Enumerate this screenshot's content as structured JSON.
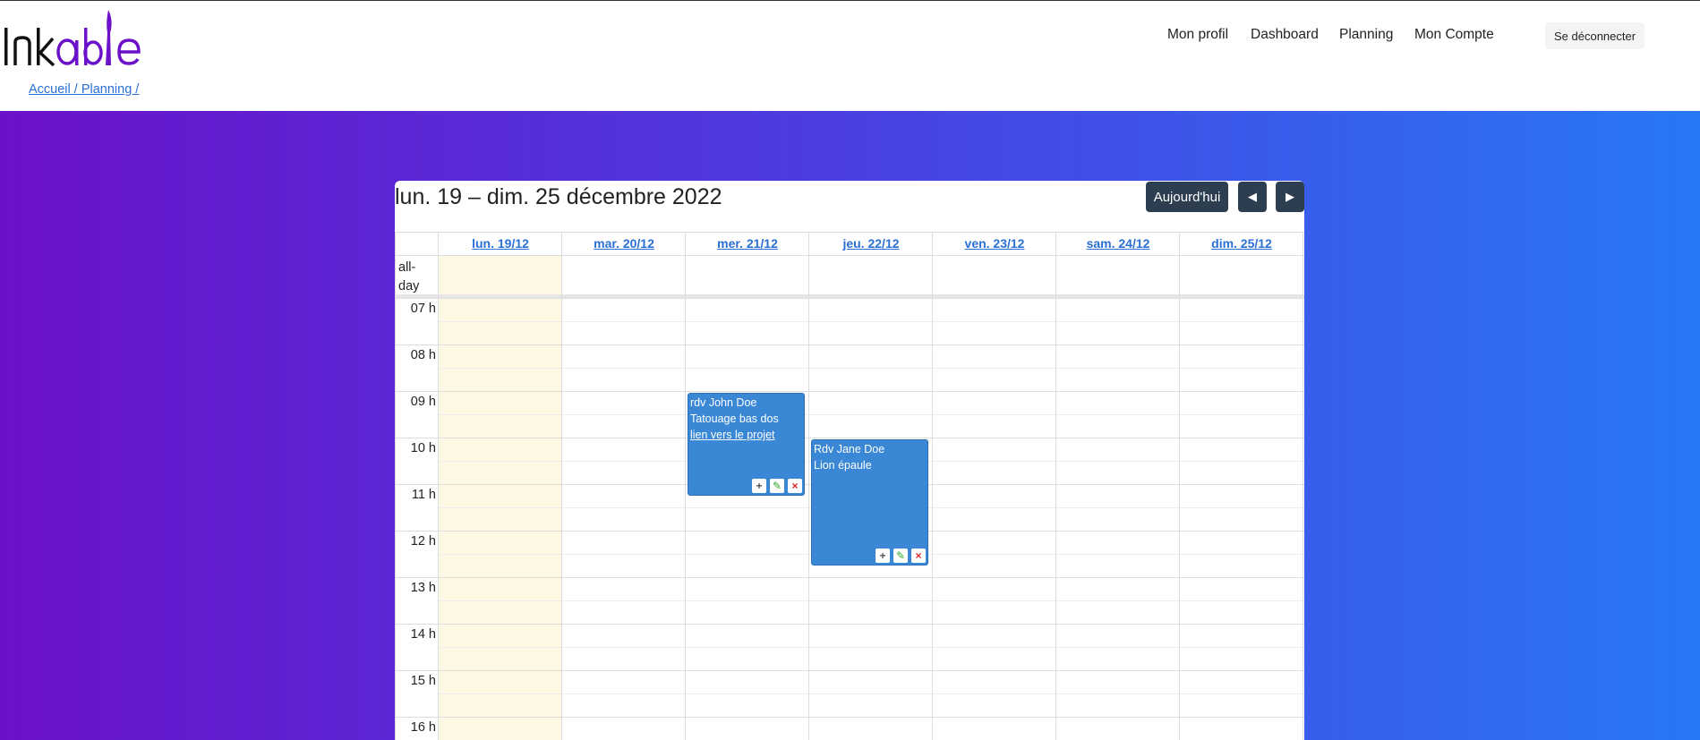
{
  "brand": {
    "name": "Inkable",
    "accent": "#6b11c9"
  },
  "nav": {
    "profile": "Mon profil",
    "dashboard": "Dashboard",
    "planning": "Planning",
    "account": "Mon Compte",
    "logout": "Se déconnecter"
  },
  "breadcrumb": "Accueil / Planning /",
  "calendar": {
    "title": "lun. 19 – dim. 25 décembre 2022",
    "today_button": "Aujourd'hui",
    "prev_icon": "◀",
    "next_icon": "▶",
    "allday_label": "all-day",
    "days": [
      "lun. 19/12",
      "mar. 20/12",
      "mer. 21/12",
      "jeu. 22/12",
      "ven. 23/12",
      "sam. 24/12",
      "dim. 25/12"
    ],
    "today_index": 0,
    "hours": [
      "07 h",
      "08 h",
      "09 h",
      "10 h",
      "11 h",
      "12 h",
      "13 h",
      "14 h",
      "15 h",
      "16 h"
    ],
    "events": [
      {
        "title": "rdv John Doe",
        "description": "Tatouage bas dos",
        "link": "lien vers le projet",
        "day_index": 2,
        "start": "09:00",
        "end": "11:15"
      },
      {
        "title": "Rdv Jane Doe",
        "description": "Lion épaule",
        "link": "",
        "day_index": 3,
        "start": "10:00",
        "end": "12:45"
      }
    ],
    "event_actions": {
      "add": "+",
      "edit": "✎",
      "delete": "×"
    }
  }
}
